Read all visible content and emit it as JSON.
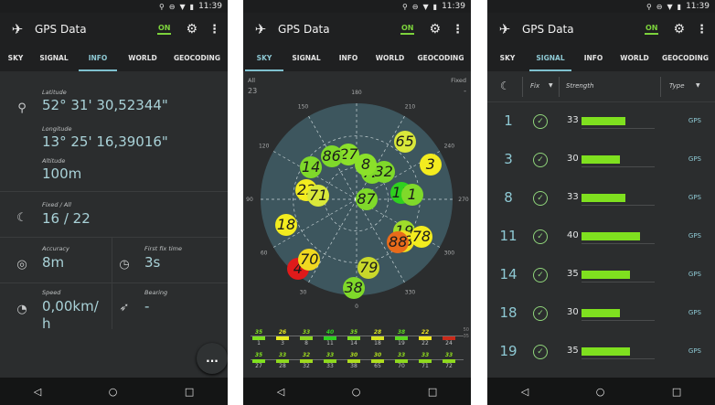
{
  "status": {
    "time": "11:39"
  },
  "app": {
    "title": "GPS Data",
    "on": "ON"
  },
  "tabs_info": [
    "SKY",
    "SIGNAL",
    "INFO",
    "WORLD",
    "GEOCODING"
  ],
  "info": {
    "latitude_label": "Latitude",
    "latitude": "52° 31' 30,52344\"",
    "longitude_label": "Longitude",
    "longitude": "13° 25' 16,39016\"",
    "altitude_label": "Altitude",
    "altitude": "100m",
    "fixed_label": "Fixed / All",
    "fixed": "16 / 22",
    "accuracy_label": "Accuracy",
    "accuracy": "8m",
    "firstfix_label": "First fix time",
    "firstfix": "3s",
    "speed_label": "Speed",
    "speed": "0,00km/\nh",
    "bearing_label": "Bearing",
    "bearing": "-",
    "fab": "..."
  },
  "sky": {
    "all_label": "All",
    "all_count": "23",
    "fixed_label": "Fixed",
    "fixed_count": "-",
    "degrees": [
      {
        "t": "0",
        "a": 0
      },
      {
        "t": "30",
        "a": 30
      },
      {
        "t": "60",
        "a": 60
      },
      {
        "t": "90",
        "a": 90
      },
      {
        "t": "120",
        "a": 120
      },
      {
        "t": "150",
        "a": 150
      },
      {
        "t": "180",
        "a": 180
      },
      {
        "t": "210",
        "a": 210
      },
      {
        "t": "240",
        "a": 240
      },
      {
        "t": "270",
        "a": 270
      },
      {
        "t": "300",
        "a": 300
      },
      {
        "t": "330",
        "a": 330
      }
    ],
    "satellites": [
      {
        "n": "65",
        "az": 220,
        "el": 0.78,
        "c": "#d9e83a"
      },
      {
        "n": "3",
        "az": 245,
        "el": 0.85,
        "c": "#f3ec1f"
      },
      {
        "n": "27",
        "az": 170,
        "el": 0.47,
        "c": "#8be02a"
      },
      {
        "n": "72",
        "az": 210,
        "el": 0.32,
        "c": "#7fd92a"
      },
      {
        "n": "32",
        "az": 225,
        "el": 0.4,
        "c": "#7fd92a"
      },
      {
        "n": "86",
        "az": 150,
        "el": 0.52,
        "c": "#7fd92a"
      },
      {
        "n": "8",
        "az": 195,
        "el": 0.37,
        "c": "#8be02a"
      },
      {
        "n": "14",
        "az": 125,
        "el": 0.58,
        "c": "#7fd92a"
      },
      {
        "n": "22",
        "az": 100,
        "el": 0.53,
        "c": "#f3ec1f"
      },
      {
        "n": "71",
        "az": 95,
        "el": 0.4,
        "c": "#d9e83a"
      },
      {
        "n": "87",
        "az": 270,
        "el": 0.1,
        "c": "#7fd92a"
      },
      {
        "n": "11",
        "az": 262,
        "el": 0.47,
        "c": "#2fd11f"
      },
      {
        "n": "1",
        "az": 265,
        "el": 0.58,
        "c": "#7fd92a"
      },
      {
        "n": "18",
        "az": 70,
        "el": 0.78,
        "c": "#f3ec1f"
      },
      {
        "n": "19",
        "az": 304,
        "el": 0.6,
        "c": "#9fdc2a"
      },
      {
        "n": "28",
        "az": 312,
        "el": 0.66,
        "c": "#f0e020"
      },
      {
        "n": "88",
        "az": 316,
        "el": 0.62,
        "c": "#e86b1a"
      },
      {
        "n": "78",
        "az": 300,
        "el": 0.78,
        "c": "#f3ec1f"
      },
      {
        "n": "4",
        "az": 40,
        "el": 0.95,
        "c": "#e01a1a"
      },
      {
        "n": "70",
        "az": 38,
        "el": 0.8,
        "c": "#f0d820"
      },
      {
        "n": "79",
        "az": 350,
        "el": 0.73,
        "c": "#c9d82a"
      },
      {
        "n": "38",
        "az": 2,
        "el": 0.92,
        "c": "#7fd92a"
      }
    ],
    "bars_top": [
      {
        "v": "35",
        "n": "1",
        "c": "#7fe01f"
      },
      {
        "v": "26",
        "n": "3",
        "c": "#e8ec1f"
      },
      {
        "v": "33",
        "n": "8",
        "c": "#8ed81f"
      },
      {
        "v": "40",
        "n": "11",
        "c": "#2ed11f"
      },
      {
        "v": "35",
        "n": "14",
        "c": "#7fe01f"
      },
      {
        "v": "28",
        "n": "18",
        "c": "#d6e41f"
      },
      {
        "v": "38",
        "n": "19",
        "c": "#5cd91f"
      },
      {
        "v": "22",
        "n": "22",
        "c": "#f3e81f"
      },
      {
        "v": "",
        "n": "24",
        "c": "#c92a1a"
      }
    ],
    "bars_bottom": [
      {
        "v": "35",
        "n": "27",
        "c": "#7fe01f"
      },
      {
        "v": "33",
        "n": "28",
        "c": "#8ed81f"
      },
      {
        "v": "32",
        "n": "32",
        "c": "#9ed81f"
      },
      {
        "v": "33",
        "n": "33",
        "c": "#8ed81f"
      },
      {
        "v": "30",
        "n": "38",
        "c": "#aedc1f"
      },
      {
        "v": "30",
        "n": "65",
        "c": "#aedc1f"
      },
      {
        "v": "33",
        "n": "70",
        "c": "#8ed81f"
      },
      {
        "v": "33",
        "n": "71",
        "c": "#8ed81f"
      },
      {
        "v": "33",
        "n": "72",
        "c": "#8ed81f"
      }
    ],
    "side_ticks": [
      "50",
      "35"
    ]
  },
  "signal": {
    "col_fix": "Fix",
    "col_strength": "Strength",
    "col_type": "Type",
    "rows": [
      {
        "n": "1",
        "s": "33",
        "w": 0.6,
        "t": "GPS"
      },
      {
        "n": "3",
        "s": "30",
        "w": 0.52,
        "t": "GPS"
      },
      {
        "n": "8",
        "s": "33",
        "w": 0.6,
        "t": "GPS"
      },
      {
        "n": "11",
        "s": "40",
        "w": 0.8,
        "t": "GPS"
      },
      {
        "n": "14",
        "s": "35",
        "w": 0.66,
        "t": "GPS"
      },
      {
        "n": "18",
        "s": "30",
        "w": 0.52,
        "t": "GPS"
      },
      {
        "n": "19",
        "s": "35",
        "w": 0.66,
        "t": "GPS"
      }
    ]
  },
  "colors": {
    "accent": "#7fc1cf",
    "on": "#7cd23c",
    "bar": "#7fe01f",
    "panel": "#2b2d2e"
  },
  "icons": [
    "location-pin-icon",
    "gps-dish-icon",
    "accuracy-icon",
    "clock-icon",
    "speedometer-icon",
    "compass-icon",
    "satellite-icon",
    "gear-icon",
    "more-vert-icon",
    "back-icon",
    "home-icon",
    "recents-icon",
    "check-circle-icon"
  ]
}
